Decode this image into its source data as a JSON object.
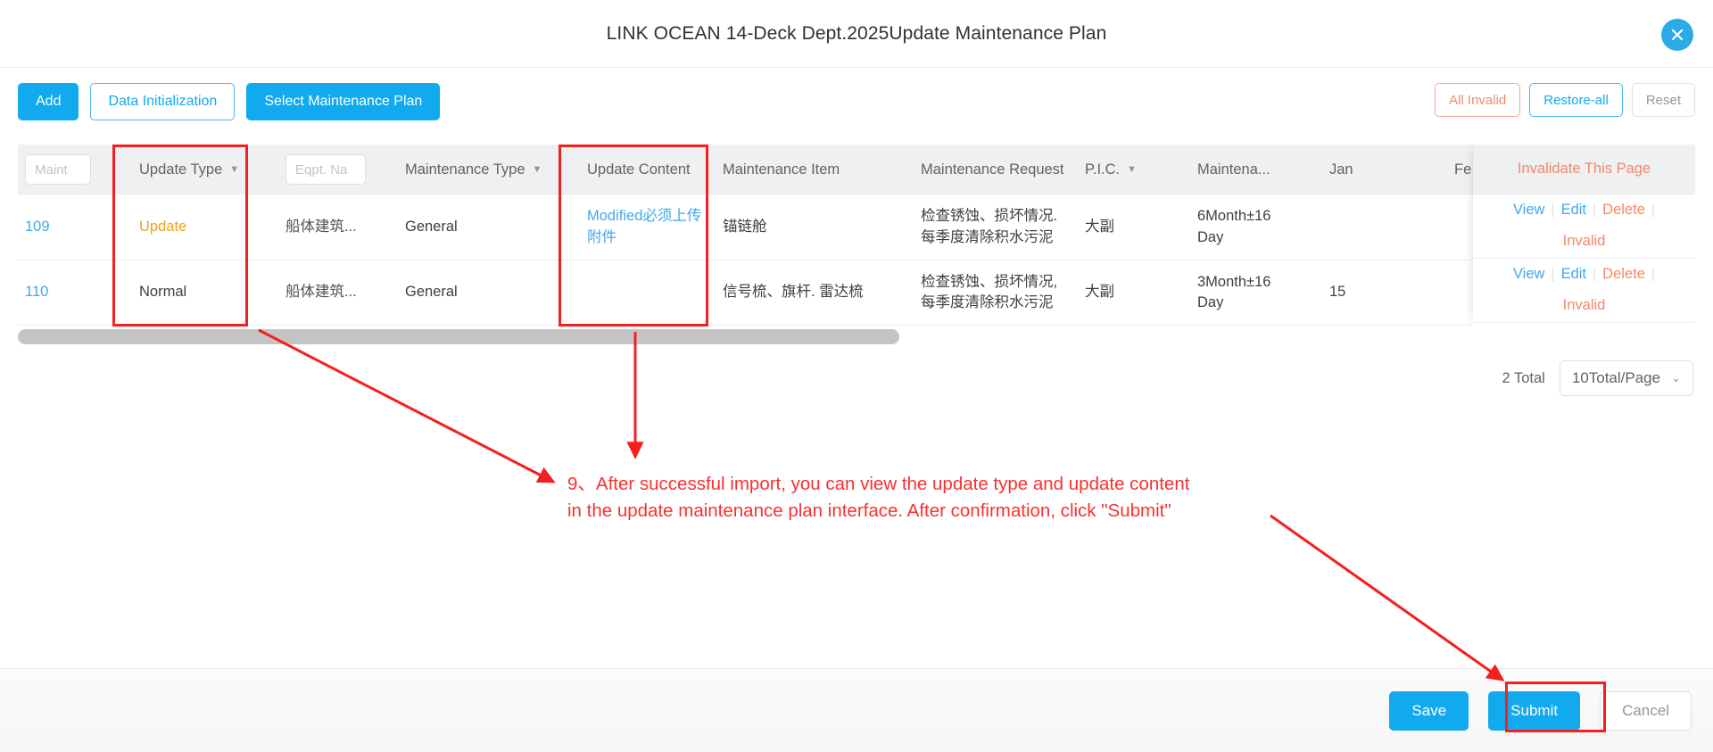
{
  "dialog": {
    "title": "LINK OCEAN 14-Deck Dept.2025Update Maintenance Plan",
    "close_icon": "close-icon"
  },
  "toolbar": {
    "left": [
      {
        "label": "Add",
        "style": "primary"
      },
      {
        "label": "Data Initialization",
        "style": "outline-blue"
      },
      {
        "label": "Select Maintenance Plan",
        "style": "primary"
      }
    ],
    "right": [
      {
        "label": "All Invalid",
        "style": "outline-red"
      },
      {
        "label": "Restore-all",
        "style": "outline-blue"
      },
      {
        "label": "Reset",
        "style": "outline-grey"
      }
    ]
  },
  "table": {
    "headers": {
      "maint_filter_placeholder": "Maint",
      "update_type": "Update Type",
      "eqpt_filter_placeholder": "Eqpt. Na",
      "maintenance_type": "Maintenance Type",
      "update_content": "Update Content",
      "maintenance_item": "Maintenance Item",
      "maintenance_request": "Maintenance Request",
      "pic": "P.I.C.",
      "maintenance_cycle": "Maintena...",
      "jan": "Jan",
      "feb": "Fe"
    },
    "fixed_column": {
      "header": "Invalidate This Page",
      "actions": [
        "View",
        "Edit",
        "Delete",
        "Invalid"
      ]
    },
    "rows": [
      {
        "id": "109",
        "update_type": "Update",
        "eqpt_name": "船体建筑...",
        "maintenance_type": "General",
        "update_content": "Modified必须上传附件",
        "maintenance_item": "锚链舱",
        "maintenance_request": "检查锈蚀、损坏情况.\n每季度清除积水污泥",
        "pic": "大副",
        "maintenance_cycle": "6Month±16 Day",
        "jan": "",
        "feb": ""
      },
      {
        "id": "110",
        "update_type": "Normal",
        "eqpt_name": "船体建筑...",
        "maintenance_type": "General",
        "update_content": "",
        "maintenance_item": "信号梳、旗杆. 雷达梳",
        "maintenance_request": "检查锈蚀、损坏情况,\n每季度清除积水污泥",
        "pic": "大副",
        "maintenance_cycle": "3Month±16 Day",
        "jan": "15",
        "feb": ""
      }
    ]
  },
  "pagination": {
    "total_label": "2 Total",
    "page_size_label": "10Total/Page",
    "chevron_icon": "chevron-down-icon"
  },
  "footer": {
    "buttons": [
      {
        "label": "Save",
        "style": "primary"
      },
      {
        "label": "Submit",
        "style": "primary"
      },
      {
        "label": "Cancel",
        "style": "outline-grey"
      }
    ]
  },
  "annotation": {
    "color": "#f93030",
    "text": "9、After successful import, you can view the update type and update content\nin the update maintenance plan interface. After confirmation, click \"Submit\""
  }
}
